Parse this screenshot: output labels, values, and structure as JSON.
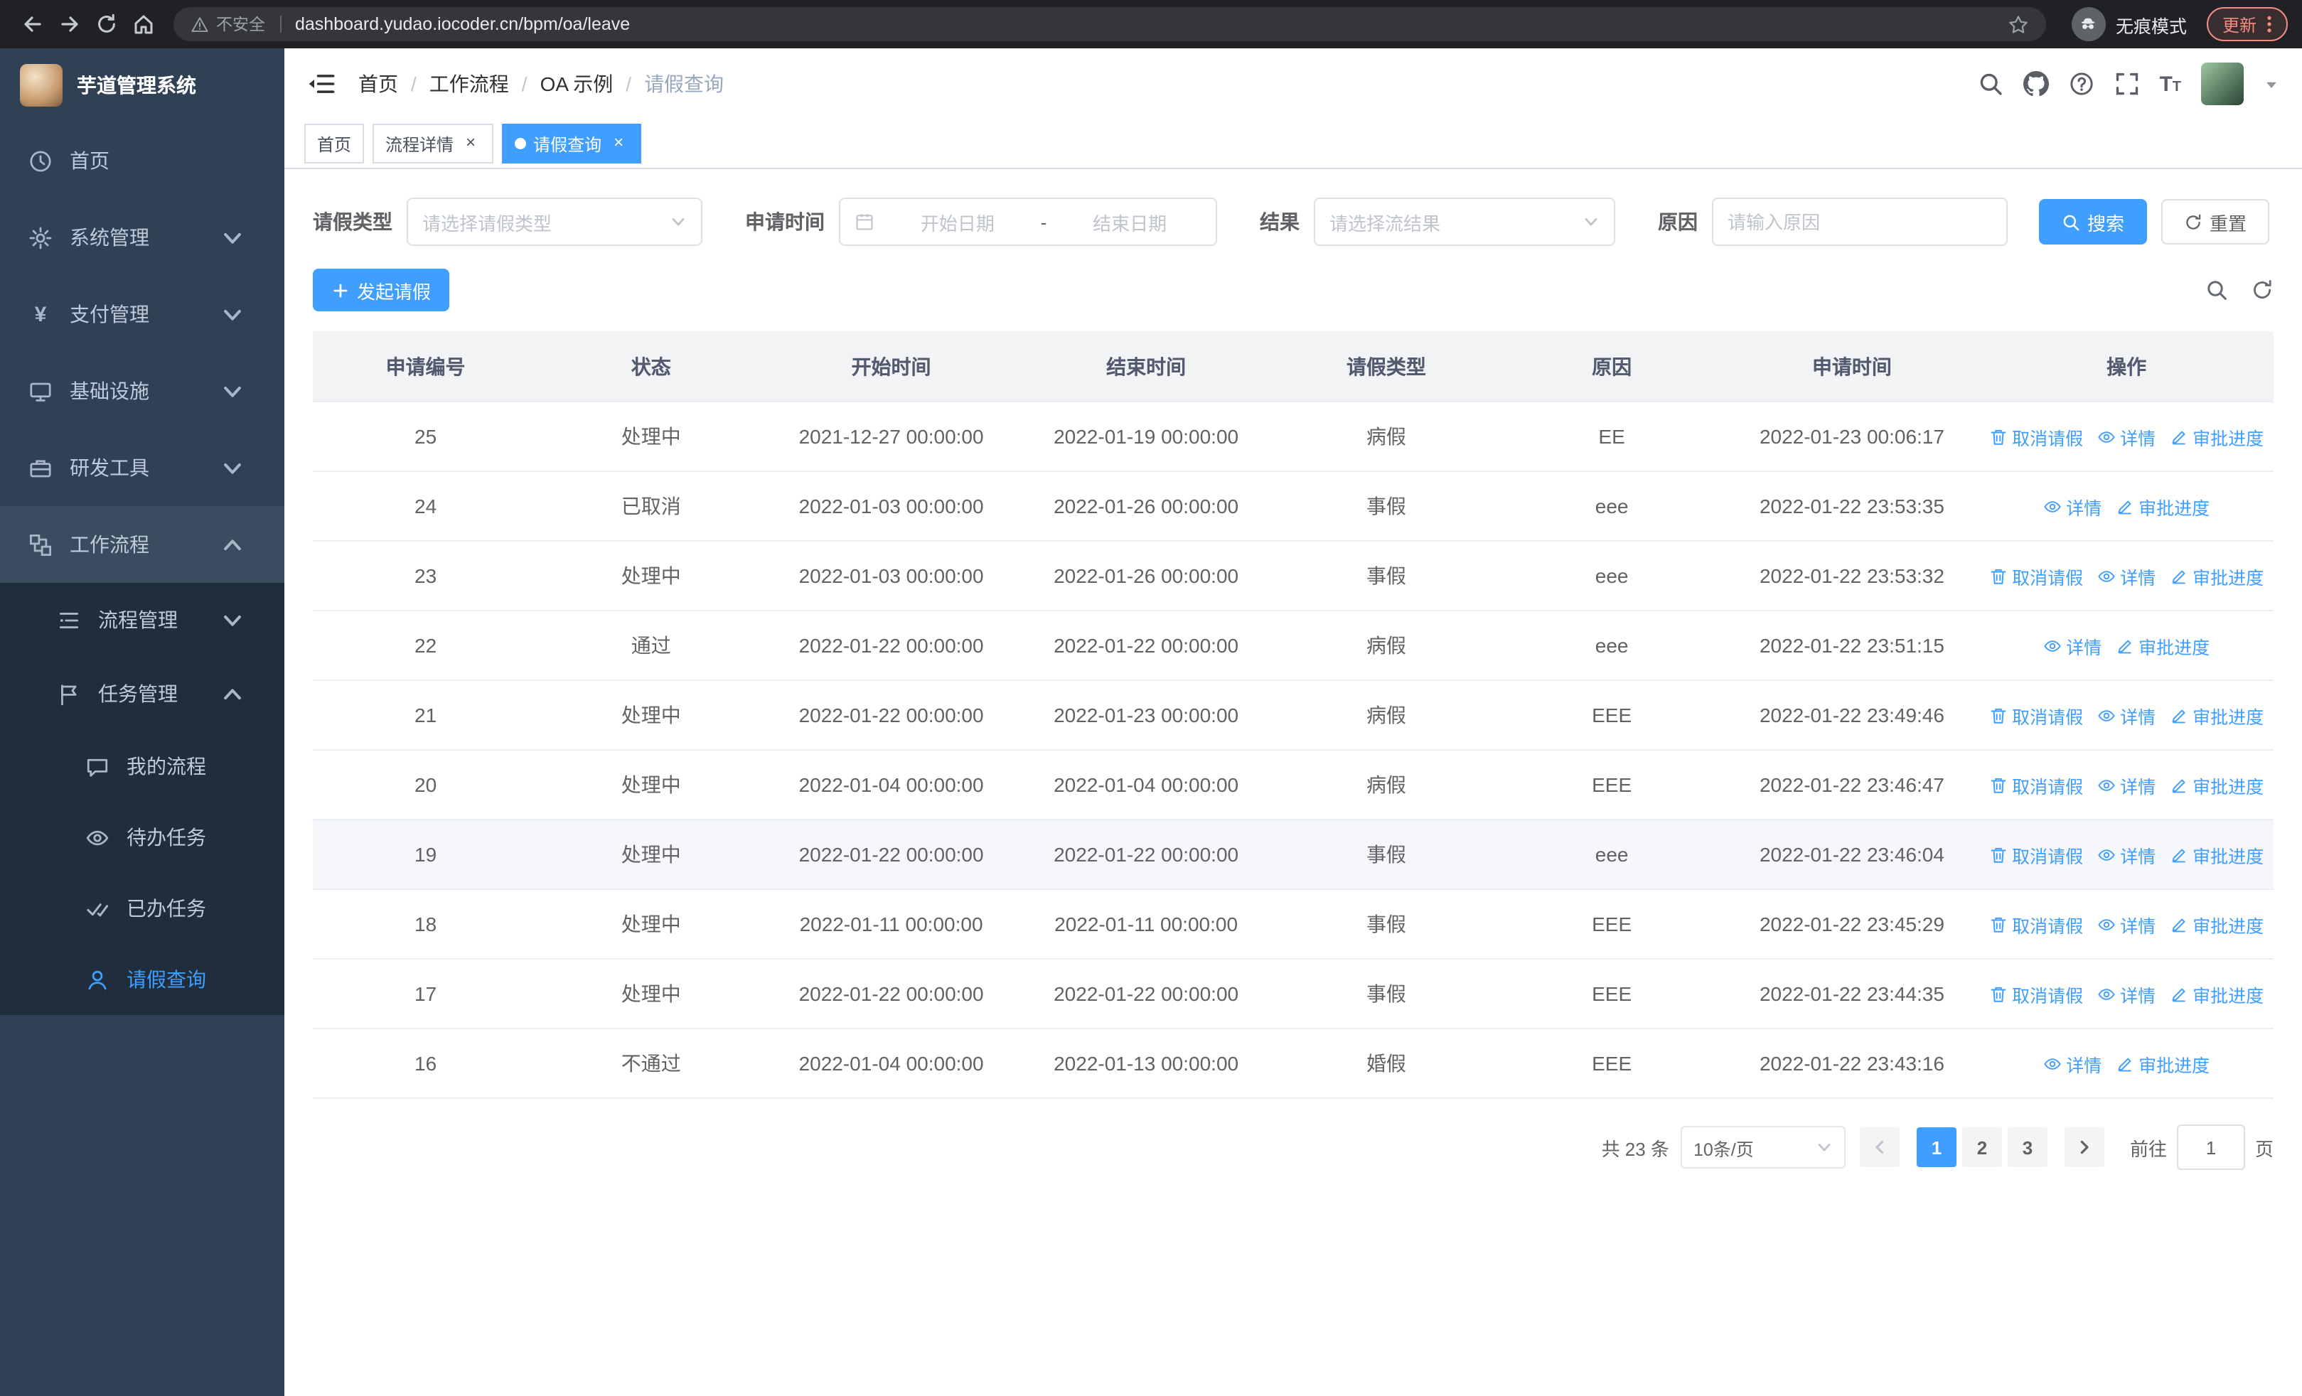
{
  "colors": {
    "primary": "#409eff",
    "sidebar_bg": "#304156",
    "sidebar_submenu_bg": "#1f2d3d",
    "tab_active_bg": "#409eff"
  },
  "browser": {
    "security_label": "不安全",
    "url": "dashboard.yudao.iocoder.cn/bpm/oa/leave",
    "incognito_label": "无痕模式",
    "update_label": "更新"
  },
  "sidebar": {
    "logo_title": "芋道管理系统",
    "items": [
      {
        "key": "home",
        "label": "首页",
        "icon": "dashboard-icon",
        "level": 1
      },
      {
        "key": "system",
        "label": "系统管理",
        "icon": "gear-icon",
        "level": 1,
        "chevron": "down"
      },
      {
        "key": "payment",
        "label": "支付管理",
        "icon": "yen-icon",
        "level": 1,
        "chevron": "down"
      },
      {
        "key": "infrastructure",
        "label": "基础设施",
        "icon": "infra-icon",
        "level": 1,
        "chevron": "down"
      },
      {
        "key": "dev-tools",
        "label": "研发工具",
        "icon": "toolbox-icon",
        "level": 1,
        "chevron": "down"
      },
      {
        "key": "workflow",
        "label": "工作流程",
        "icon": "workflow-icon",
        "level": 1,
        "chevron": "up",
        "open": true
      },
      {
        "key": "process-mgmt",
        "label": "流程管理",
        "icon": "process-icon",
        "level": 2,
        "chevron": "down"
      },
      {
        "key": "task-mgmt",
        "label": "任务管理",
        "icon": "task-icon",
        "level": 2,
        "chevron": "up"
      },
      {
        "key": "my-process",
        "label": "我的流程",
        "icon": "chat-icon",
        "level": 3
      },
      {
        "key": "todo-tasks",
        "label": "待办任务",
        "icon": "view-icon",
        "level": 3
      },
      {
        "key": "done-tasks",
        "label": "已办任务",
        "icon": "done-icon",
        "level": 3
      },
      {
        "key": "leave-query",
        "label": "请假查询",
        "icon": "user-icon",
        "level": 3,
        "active": true
      }
    ]
  },
  "header": {
    "breadcrumb": [
      "首页",
      "工作流程",
      "OA 示例",
      "请假查询"
    ]
  },
  "tabs": [
    {
      "key": "home",
      "label": "首页",
      "closable": false,
      "active": false
    },
    {
      "key": "process-detail",
      "label": "流程详情",
      "closable": true,
      "active": false
    },
    {
      "key": "leave-query",
      "label": "请假查询",
      "closable": true,
      "active": true
    }
  ],
  "filters": {
    "leave_type_label": "请假类型",
    "leave_type_placeholder": "请选择请假类型",
    "apply_time_label": "申请时间",
    "start_date_placeholder": "开始日期",
    "range_separator": "-",
    "end_date_placeholder": "结束日期",
    "result_label": "结果",
    "result_placeholder": "请选择流结果",
    "reason_label": "原因",
    "reason_placeholder": "请输入原因",
    "search_button": "搜索",
    "reset_button": "重置"
  },
  "toolbar": {
    "create_button": "发起请假"
  },
  "table": {
    "columns": [
      "申请编号",
      "状态",
      "开始时间",
      "结束时间",
      "请假类型",
      "原因",
      "申请时间",
      "操作"
    ],
    "action_labels": {
      "cancel": "取消请假",
      "detail": "详情",
      "progress": "审批进度"
    },
    "rows": [
      {
        "id": "25",
        "status": "处理中",
        "start": "2021-12-27 00:00:00",
        "end": "2022-01-19 00:00:00",
        "type": "病假",
        "reason": "EE",
        "applied": "2022-01-23 00:06:17",
        "actions": [
          "cancel",
          "detail",
          "progress"
        ]
      },
      {
        "id": "24",
        "status": "已取消",
        "start": "2022-01-03 00:00:00",
        "end": "2022-01-26 00:00:00",
        "type": "事假",
        "reason": "eee",
        "applied": "2022-01-22 23:53:35",
        "actions": [
          "detail",
          "progress"
        ]
      },
      {
        "id": "23",
        "status": "处理中",
        "start": "2022-01-03 00:00:00",
        "end": "2022-01-26 00:00:00",
        "type": "事假",
        "reason": "eee",
        "applied": "2022-01-22 23:53:32",
        "actions": [
          "cancel",
          "detail",
          "progress"
        ]
      },
      {
        "id": "22",
        "status": "通过",
        "start": "2022-01-22 00:00:00",
        "end": "2022-01-22 00:00:00",
        "type": "病假",
        "reason": "eee",
        "applied": "2022-01-22 23:51:15",
        "actions": [
          "detail",
          "progress"
        ]
      },
      {
        "id": "21",
        "status": "处理中",
        "start": "2022-01-22 00:00:00",
        "end": "2022-01-23 00:00:00",
        "type": "病假",
        "reason": "EEE",
        "applied": "2022-01-22 23:49:46",
        "actions": [
          "cancel",
          "detail",
          "progress"
        ]
      },
      {
        "id": "20",
        "status": "处理中",
        "start": "2022-01-04 00:00:00",
        "end": "2022-01-04 00:00:00",
        "type": "病假",
        "reason": "EEE",
        "applied": "2022-01-22 23:46:47",
        "actions": [
          "cancel",
          "detail",
          "progress"
        ]
      },
      {
        "id": "19",
        "status": "处理中",
        "start": "2022-01-22 00:00:00",
        "end": "2022-01-22 00:00:00",
        "type": "事假",
        "reason": "eee",
        "applied": "2022-01-22 23:46:04",
        "actions": [
          "cancel",
          "detail",
          "progress"
        ],
        "highlight": true
      },
      {
        "id": "18",
        "status": "处理中",
        "start": "2022-01-11 00:00:00",
        "end": "2022-01-11 00:00:00",
        "type": "事假",
        "reason": "EEE",
        "applied": "2022-01-22 23:45:29",
        "actions": [
          "cancel",
          "detail",
          "progress"
        ]
      },
      {
        "id": "17",
        "status": "处理中",
        "start": "2022-01-22 00:00:00",
        "end": "2022-01-22 00:00:00",
        "type": "事假",
        "reason": "EEE",
        "applied": "2022-01-22 23:44:35",
        "actions": [
          "cancel",
          "detail",
          "progress"
        ]
      },
      {
        "id": "16",
        "status": "不通过",
        "start": "2022-01-04 00:00:00",
        "end": "2022-01-13 00:00:00",
        "type": "婚假",
        "reason": "EEE",
        "applied": "2022-01-22 23:43:16",
        "actions": [
          "detail",
          "progress"
        ]
      }
    ]
  },
  "pagination": {
    "total_text": "共 23 条",
    "page_size": "10条/页",
    "pages": [
      "1",
      "2",
      "3"
    ],
    "active_page": "1",
    "goto_label": "前往",
    "goto_value": "1",
    "goto_suffix": "页"
  }
}
